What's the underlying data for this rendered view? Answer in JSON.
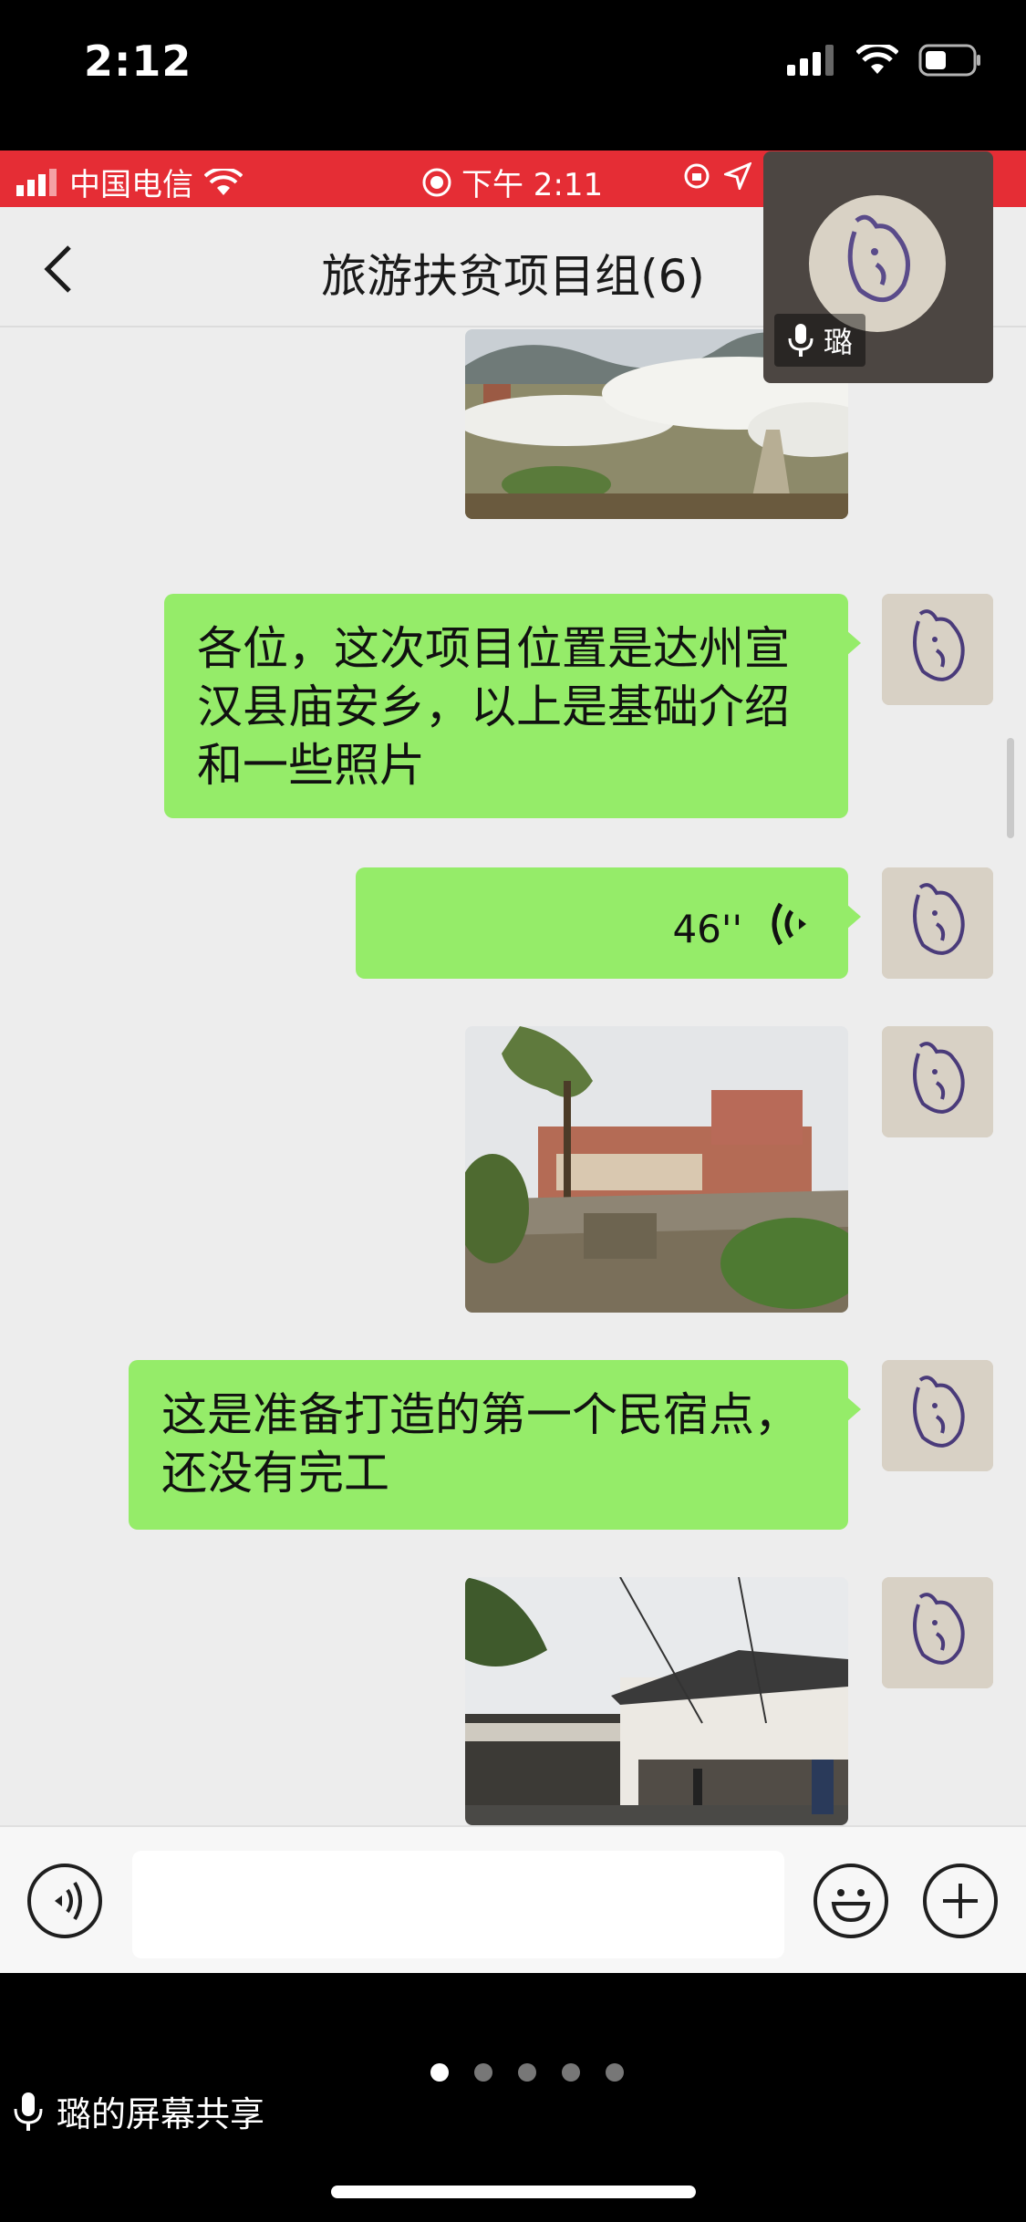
{
  "outer_status": {
    "time": "2:12"
  },
  "inner_status": {
    "carrier": "中国电信",
    "time": "下午 2:11"
  },
  "chat": {
    "title": "旅游扶贫项目组(6)"
  },
  "video_tile": {
    "name": "璐"
  },
  "messages": [
    {
      "type": "image",
      "description_icon": "orchard-photo-icon"
    },
    {
      "type": "text",
      "text": "各位，这次项目位置是达州宣汉县庙安乡，以上是基础介绍和一些照片"
    },
    {
      "type": "voice",
      "duration": "46''"
    },
    {
      "type": "image",
      "description_icon": "construction-photo-icon"
    },
    {
      "type": "text",
      "text": "这是准备打造的第一个民宿点，还没有完工"
    },
    {
      "type": "image",
      "description_icon": "village-photo-icon"
    }
  ],
  "input": {
    "value": "",
    "placeholder": ""
  },
  "share": {
    "label": "璐的屏幕共享",
    "pages": 5,
    "active_page": 1
  },
  "colors": {
    "bubble": "#95ec69",
    "inner_status_bar": "#e52d35",
    "background": "#ededed"
  }
}
